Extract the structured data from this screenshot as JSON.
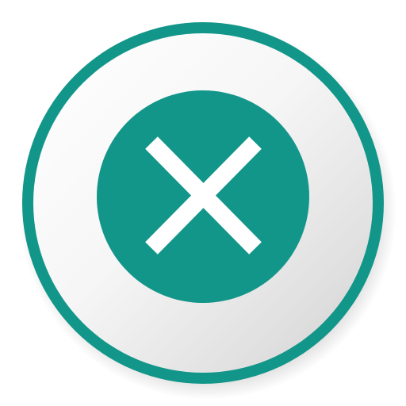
{
  "app_icon": {
    "icon_name": "close-icon",
    "description_name": "x-mark",
    "colors": {
      "accent": "#13968a",
      "disc_light": "#ffffff",
      "disc_shade": "#d4d4d4",
      "mark": "#ffffff",
      "background": "#ffffff"
    }
  }
}
